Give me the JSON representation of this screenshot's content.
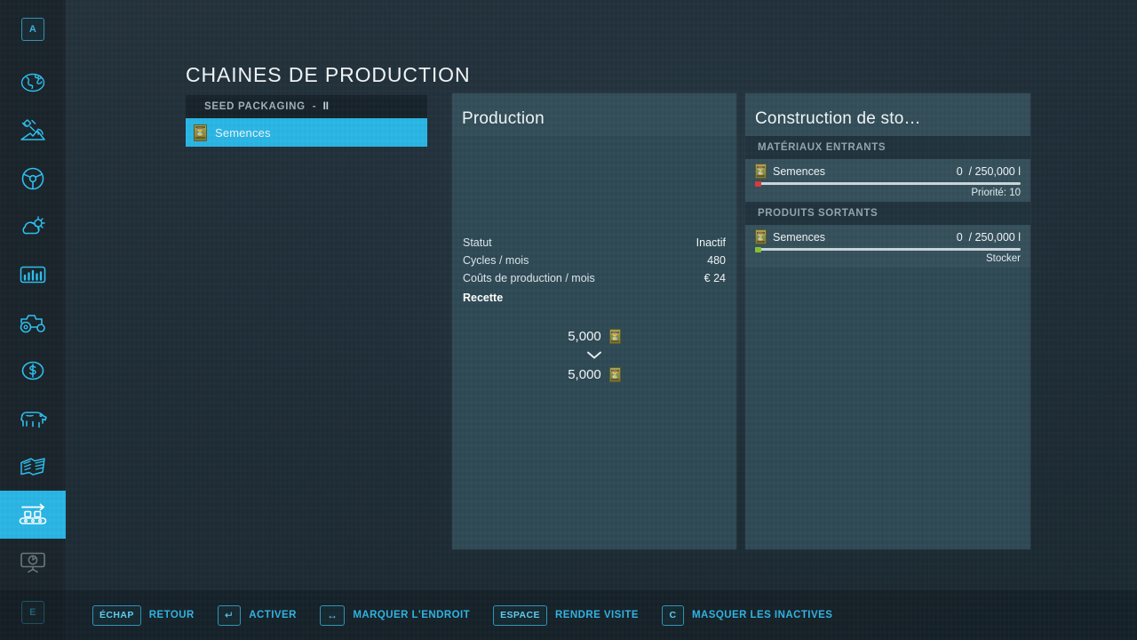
{
  "theme": {
    "accent": "#29b6e6",
    "panel_bg": "#2f4a55",
    "page_bg": "#1e2d37",
    "status_red": "#d63a3a",
    "status_green": "#86c232"
  },
  "sidebar": {
    "top_key": "A",
    "bottom_key": "E",
    "items": [
      {
        "icon": "globe-map-icon",
        "name": "map",
        "active": false,
        "disabled": false
      },
      {
        "icon": "satellite-terrain-icon",
        "name": "terrain",
        "active": false,
        "disabled": false
      },
      {
        "icon": "steering-wheel-icon",
        "name": "vehicles",
        "active": false,
        "disabled": false
      },
      {
        "icon": "weather-cloud-sun-icon",
        "name": "weather",
        "active": false,
        "disabled": false
      },
      {
        "icon": "bar-chart-icon",
        "name": "statistics",
        "active": false,
        "disabled": false
      },
      {
        "icon": "tractor-icon",
        "name": "machinery",
        "active": false,
        "disabled": false
      },
      {
        "icon": "dollar-coin-icon",
        "name": "finances",
        "active": false,
        "disabled": false
      },
      {
        "icon": "cow-icon",
        "name": "animals",
        "active": false,
        "disabled": false
      },
      {
        "icon": "contracts-icon",
        "name": "contracts",
        "active": false,
        "disabled": false
      },
      {
        "icon": "conveyor-belt-icon",
        "name": "productions",
        "active": true,
        "disabled": false
      },
      {
        "icon": "presentation-icon",
        "name": "presentation",
        "active": false,
        "disabled": true
      }
    ]
  },
  "header": {
    "title": "CHAINES DE PRODUCTION"
  },
  "chain_list": {
    "group": {
      "name": "SEED PACKAGING",
      "separator": "-",
      "level": "II"
    },
    "rows": [
      {
        "label": "Semences",
        "icon": "seed-bag-icon",
        "selected": true
      }
    ]
  },
  "production": {
    "title": "Production",
    "stats": [
      {
        "key": "Statut",
        "value": "Inactif"
      },
      {
        "key": "Cycles / mois",
        "value": "480"
      },
      {
        "key": "Coûts de production / mois",
        "value": "€ 24"
      }
    ],
    "recipe_label": "Recette",
    "recipe": {
      "input": {
        "amount": "5,000",
        "icon": "seed-bag-icon"
      },
      "arrow": "chevron-down-icon",
      "output": {
        "amount": "5,000",
        "icon": "seed-bag-icon"
      }
    }
  },
  "storage": {
    "title": "Construction de sto…",
    "sections": [
      {
        "heading": "MATÉRIAUX ENTRANTS",
        "rows": [
          {
            "name": "Semences",
            "icon": "seed-bag-icon",
            "current": "0",
            "separator": " / ",
            "capacity": "250,000 l",
            "amount_text": "0  / 250,000 l",
            "fill_percent": 0,
            "dot_color": "red",
            "footer": "Priorité: 10"
          }
        ]
      },
      {
        "heading": "PRODUITS SORTANTS",
        "rows": [
          {
            "name": "Semences",
            "icon": "seed-bag-icon",
            "current": "0",
            "separator": " / ",
            "capacity": "250,000 l",
            "amount_text": "0  / 250,000 l",
            "fill_percent": 0,
            "dot_color": "green",
            "footer": "Stocker"
          }
        ]
      }
    ]
  },
  "footer": {
    "hints": [
      {
        "key": "ÉCHAP",
        "key_kind": "text",
        "label": "RETOUR"
      },
      {
        "key": "↵",
        "key_kind": "sym",
        "label": "ACTIVER"
      },
      {
        "key": "↔",
        "key_kind": "sym",
        "label": "MARQUER L'ENDROIT"
      },
      {
        "key": "ESPACE",
        "key_kind": "text",
        "label": "RENDRE VISITE"
      },
      {
        "key": "C",
        "key_kind": "text",
        "label": "MASQUER LES INACTIVES"
      }
    ]
  }
}
